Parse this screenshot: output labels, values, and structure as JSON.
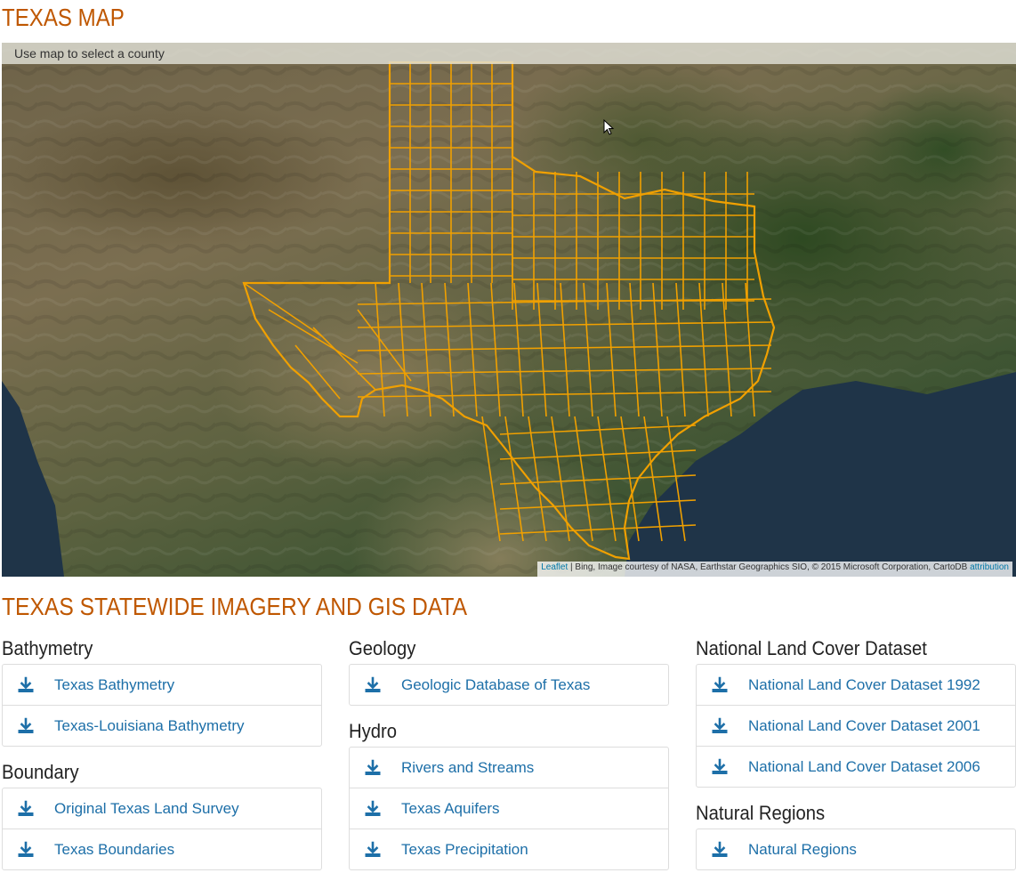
{
  "page": {
    "title": "TEXAS MAP"
  },
  "map": {
    "banner_text": "Use map to select a county",
    "attribution": {
      "leaflet_link": "Leaflet",
      "text": " | Bing, Image courtesy of NASA, Earthstar Geographics SIO, © 2015 Microsoft Corporation, CartoDB ",
      "attribution_link": "attribution"
    },
    "border_color": "#f0a000"
  },
  "section": {
    "title": "TEXAS STATEWIDE IMAGERY AND GIS DATA"
  },
  "columns": [
    {
      "groups": [
        {
          "heading": "Bathymetry",
          "items": [
            "Texas Bathymetry",
            "Texas-Louisiana Bathymetry"
          ]
        },
        {
          "heading": "Boundary",
          "items": [
            "Original Texas Land Survey",
            "Texas Boundaries"
          ]
        }
      ]
    },
    {
      "groups": [
        {
          "heading": "Geology",
          "items": [
            "Geologic Database of Texas"
          ]
        },
        {
          "heading": "Hydro",
          "items": [
            "Rivers and Streams",
            "Texas Aquifers",
            "Texas Precipitation"
          ]
        }
      ]
    },
    {
      "groups": [
        {
          "heading": "National Land Cover Dataset",
          "items": [
            "National Land Cover Dataset 1992",
            "National Land Cover Dataset 2001",
            "National Land Cover Dataset 2006"
          ]
        },
        {
          "heading": "Natural Regions",
          "items": [
            "Natural Regions"
          ]
        }
      ]
    }
  ],
  "icons": {
    "item_icon": "download-icon"
  },
  "colors": {
    "accent": "#bf5700",
    "link": "#1d6fa8"
  }
}
